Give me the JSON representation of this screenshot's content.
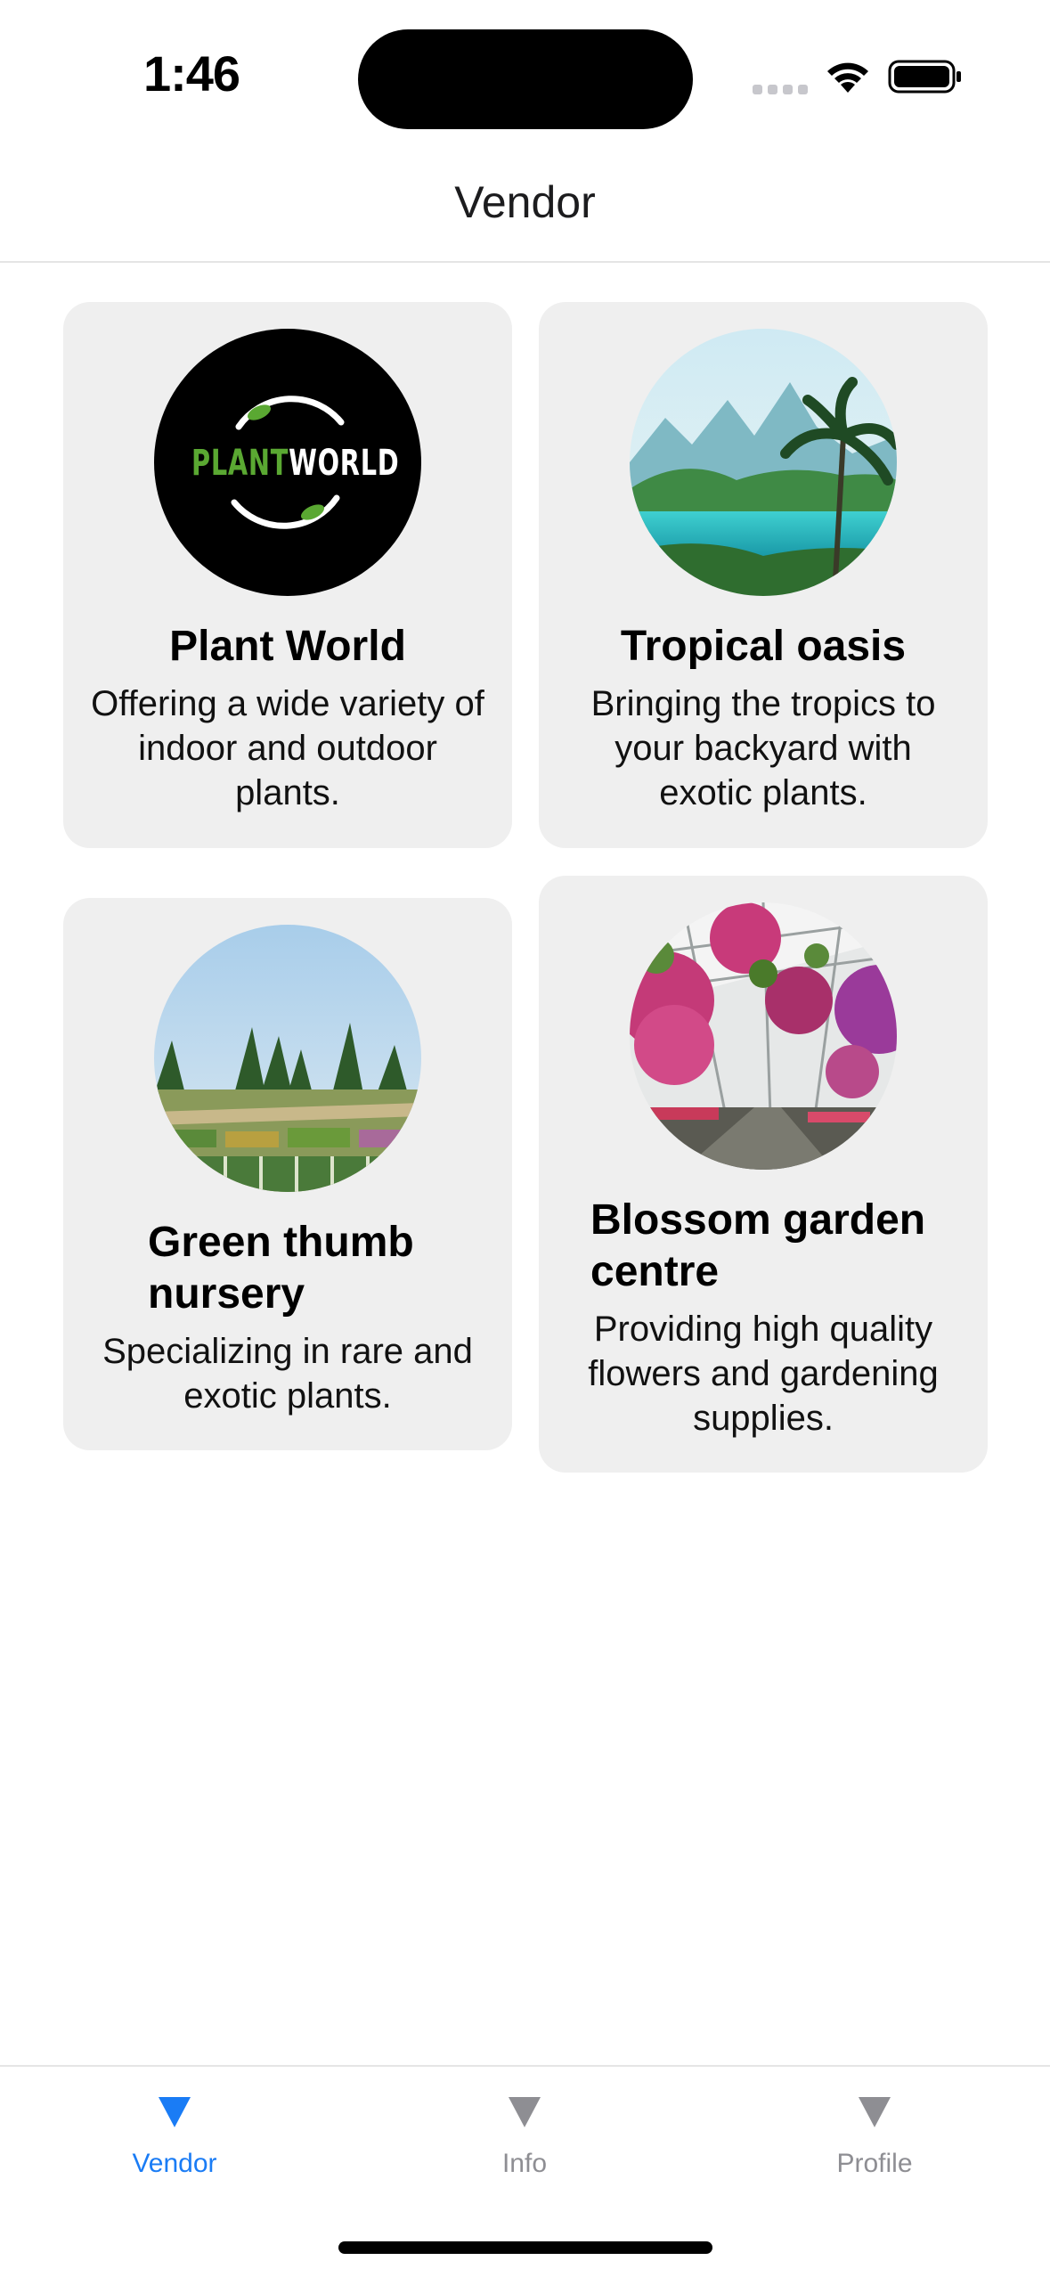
{
  "status_bar": {
    "time": "1:46"
  },
  "header": {
    "title": "Vendor"
  },
  "vendors": [
    {
      "name": "Plant World",
      "description": "Offering a wide variety of indoor and outdoor plants.",
      "logo_text_green": "PLANT",
      "logo_text_white": "WORLD"
    },
    {
      "name": "Tropical oasis",
      "description": "Bringing the tropics to your backyard with exotic plants."
    },
    {
      "name": "Green thumb nursery",
      "description": "Specializing in rare and exotic plants."
    },
    {
      "name": "Blossom garden centre",
      "description": "Providing high quality flowers and gardening supplies."
    }
  ],
  "tab_bar": {
    "tabs": [
      {
        "label": "Vendor",
        "icon": "triangle-down-icon",
        "active": true
      },
      {
        "label": "Info",
        "icon": "triangle-down-icon",
        "active": false
      },
      {
        "label": "Profile",
        "icon": "triangle-down-icon",
        "active": false
      }
    ]
  },
  "colors": {
    "accent": "#1a7cf5",
    "inactive": "#8e8e93",
    "card_bg": "#efefef",
    "logo_green": "#5aa832"
  }
}
